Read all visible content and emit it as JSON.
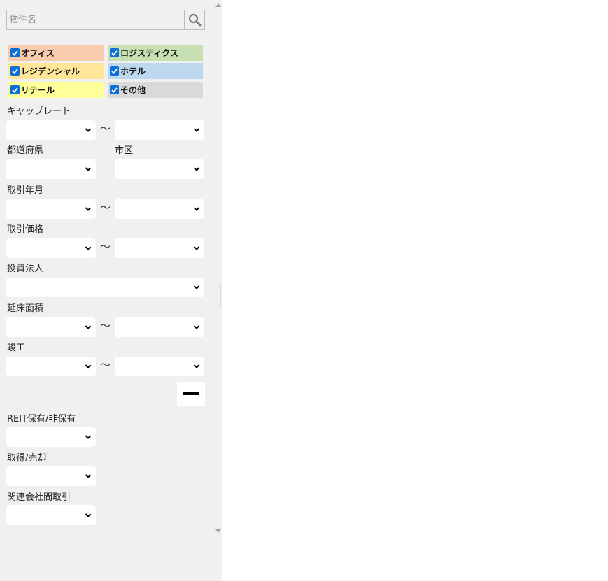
{
  "search": {
    "placeholder": "物件名",
    "icon": "search-icon"
  },
  "categories": [
    {
      "label": "オフィス",
      "checked": true,
      "color": "#f8cbad"
    },
    {
      "label": "ロジスティクス",
      "checked": true,
      "color": "#c6e0b4"
    },
    {
      "label": "レジデンシャル",
      "checked": true,
      "color": "#ffe699"
    },
    {
      "label": "ホテル",
      "checked": true,
      "color": "#bdd7ee"
    },
    {
      "label": "リテール",
      "checked": true,
      "color": "#ffff99"
    },
    {
      "label": "その他",
      "checked": true,
      "color": "#d9d9d9"
    }
  ],
  "filters": {
    "cap_rate": {
      "label": "キャップレート",
      "from": "",
      "to": ""
    },
    "prefecture": {
      "label": "都道府県",
      "value": ""
    },
    "city": {
      "label": "市区",
      "value": ""
    },
    "transaction_date": {
      "label": "取引年月",
      "from": "",
      "to": ""
    },
    "transaction_price": {
      "label": "取引価格",
      "from": "",
      "to": ""
    },
    "investor": {
      "label": "投資法人",
      "value": ""
    },
    "floor_area": {
      "label": "延床面積",
      "from": "",
      "to": ""
    },
    "completion": {
      "label": "竣工",
      "from": "",
      "to": ""
    },
    "reit_holding": {
      "label": "REIT保有/非保有",
      "value": ""
    },
    "acquire_sell": {
      "label": "取得/売却",
      "value": ""
    },
    "related_party": {
      "label": "関連会社間取引",
      "value": ""
    }
  },
  "range_separator": "〜",
  "colors": {
    "panel_bg": "#f0f0f0",
    "checkbox_accent": "#0b6fd6"
  }
}
